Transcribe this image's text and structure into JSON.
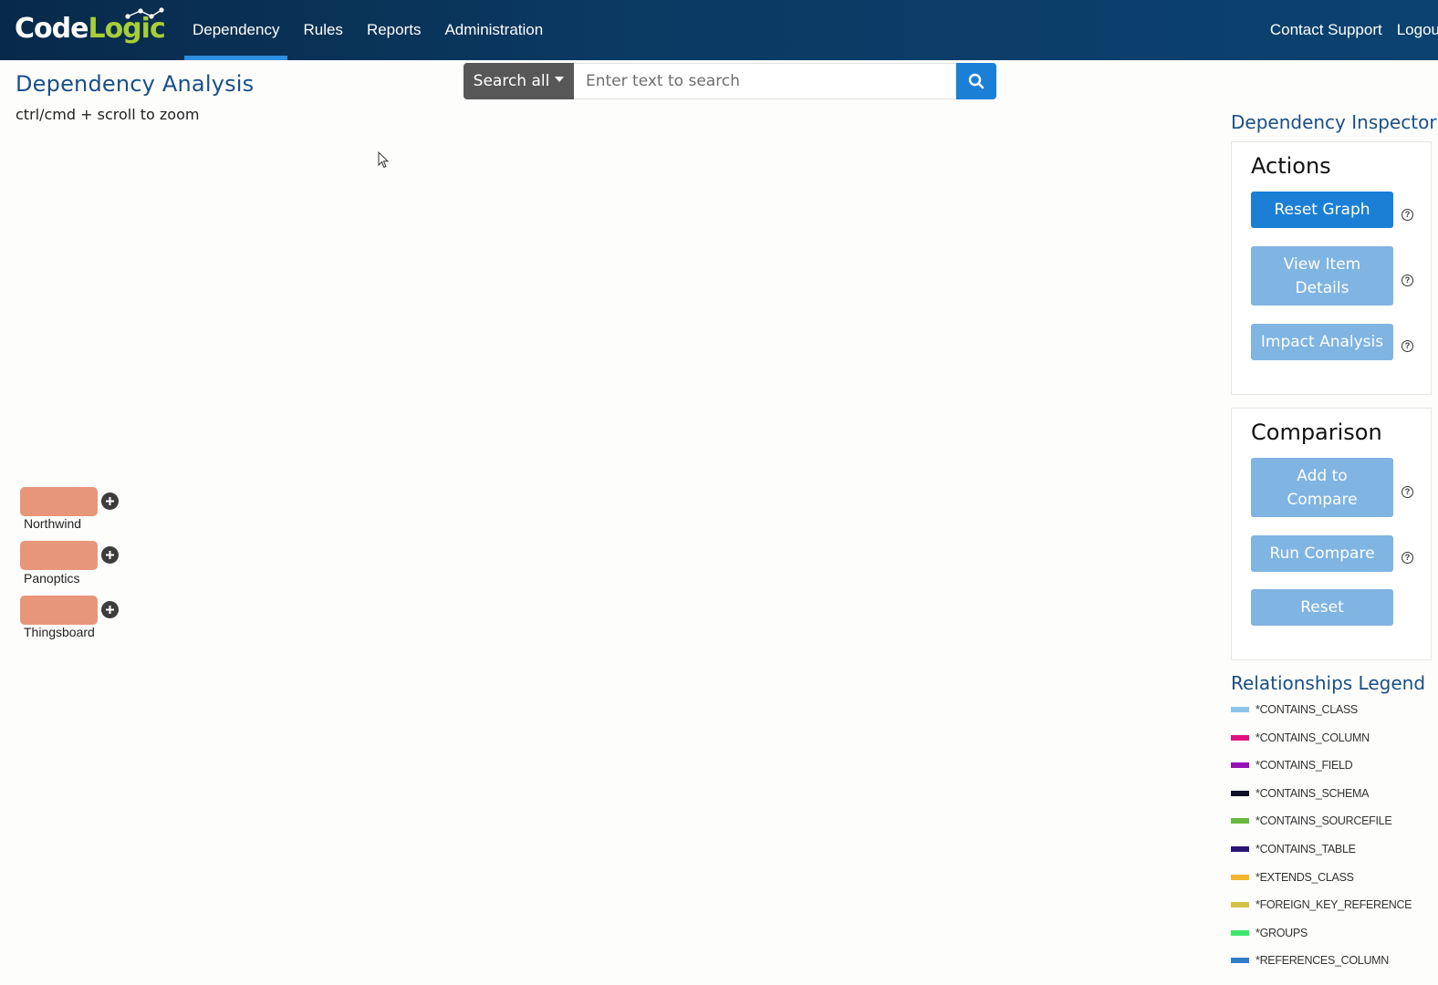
{
  "header": {
    "logo_part1": "Code",
    "logo_part2": "Logic",
    "nav": [
      {
        "label": "Dependency",
        "active": true
      },
      {
        "label": "Rules"
      },
      {
        "label": "Reports"
      },
      {
        "label": "Administration"
      }
    ],
    "right": [
      {
        "label": "Contact Support"
      },
      {
        "label": "Logou"
      }
    ]
  },
  "page": {
    "title": "Dependency Analysis",
    "hint": "ctrl/cmd + scroll to zoom"
  },
  "search": {
    "scope_label": "Search all",
    "placeholder": "Enter text to search",
    "icon": "search-icon"
  },
  "graph": {
    "nodes": [
      {
        "label": "Northwind",
        "color": "#e8967a"
      },
      {
        "label": "Panoptics",
        "color": "#e8967a"
      },
      {
        "label": "Thingsboard",
        "color": "#e8967a"
      }
    ]
  },
  "inspector": {
    "title": "Dependency Inspector",
    "actions": {
      "title": "Actions",
      "buttons": [
        {
          "label": "Reset Graph",
          "state": "enabled"
        },
        {
          "label": "View Item Details",
          "state": "disabled"
        },
        {
          "label": "Impact Analysis",
          "state": "disabled"
        }
      ]
    },
    "comparison": {
      "title": "Comparison",
      "buttons": [
        {
          "label": "Add to Compare",
          "state": "disabled"
        },
        {
          "label": "Run Compare",
          "state": "disabled"
        },
        {
          "label": "Reset",
          "state": "disabled"
        }
      ]
    },
    "help_glyph": "?"
  },
  "legend": {
    "title": "Relationships Legend",
    "items": [
      {
        "label": "*CONTAINS_CLASS",
        "color": "#8ec5ec"
      },
      {
        "label": "*CONTAINS_COLUMN",
        "color": "#e0117f"
      },
      {
        "label": "*CONTAINS_FIELD",
        "color": "#9510b5"
      },
      {
        "label": "*CONTAINS_SCHEMA",
        "color": "#0d1026"
      },
      {
        "label": "*CONTAINS_SOURCEFILE",
        "color": "#6bb93e"
      },
      {
        "label": "*CONTAINS_TABLE",
        "color": "#2a1476"
      },
      {
        "label": "*EXTENDS_CLASS",
        "color": "#f2b42c"
      },
      {
        "label": "*FOREIGN_KEY_REFERENCE",
        "color": "#d4c243"
      },
      {
        "label": "*GROUPS",
        "color": "#3ee86a"
      },
      {
        "label": "*REFERENCES_COLUMN",
        "color": "#2f7fc8"
      }
    ]
  },
  "colors": {
    "header_bg": "#0b3a63",
    "accent": "#1b7fd6",
    "title_blue": "#1a4f86",
    "logo_green": "#a6ce39"
  }
}
